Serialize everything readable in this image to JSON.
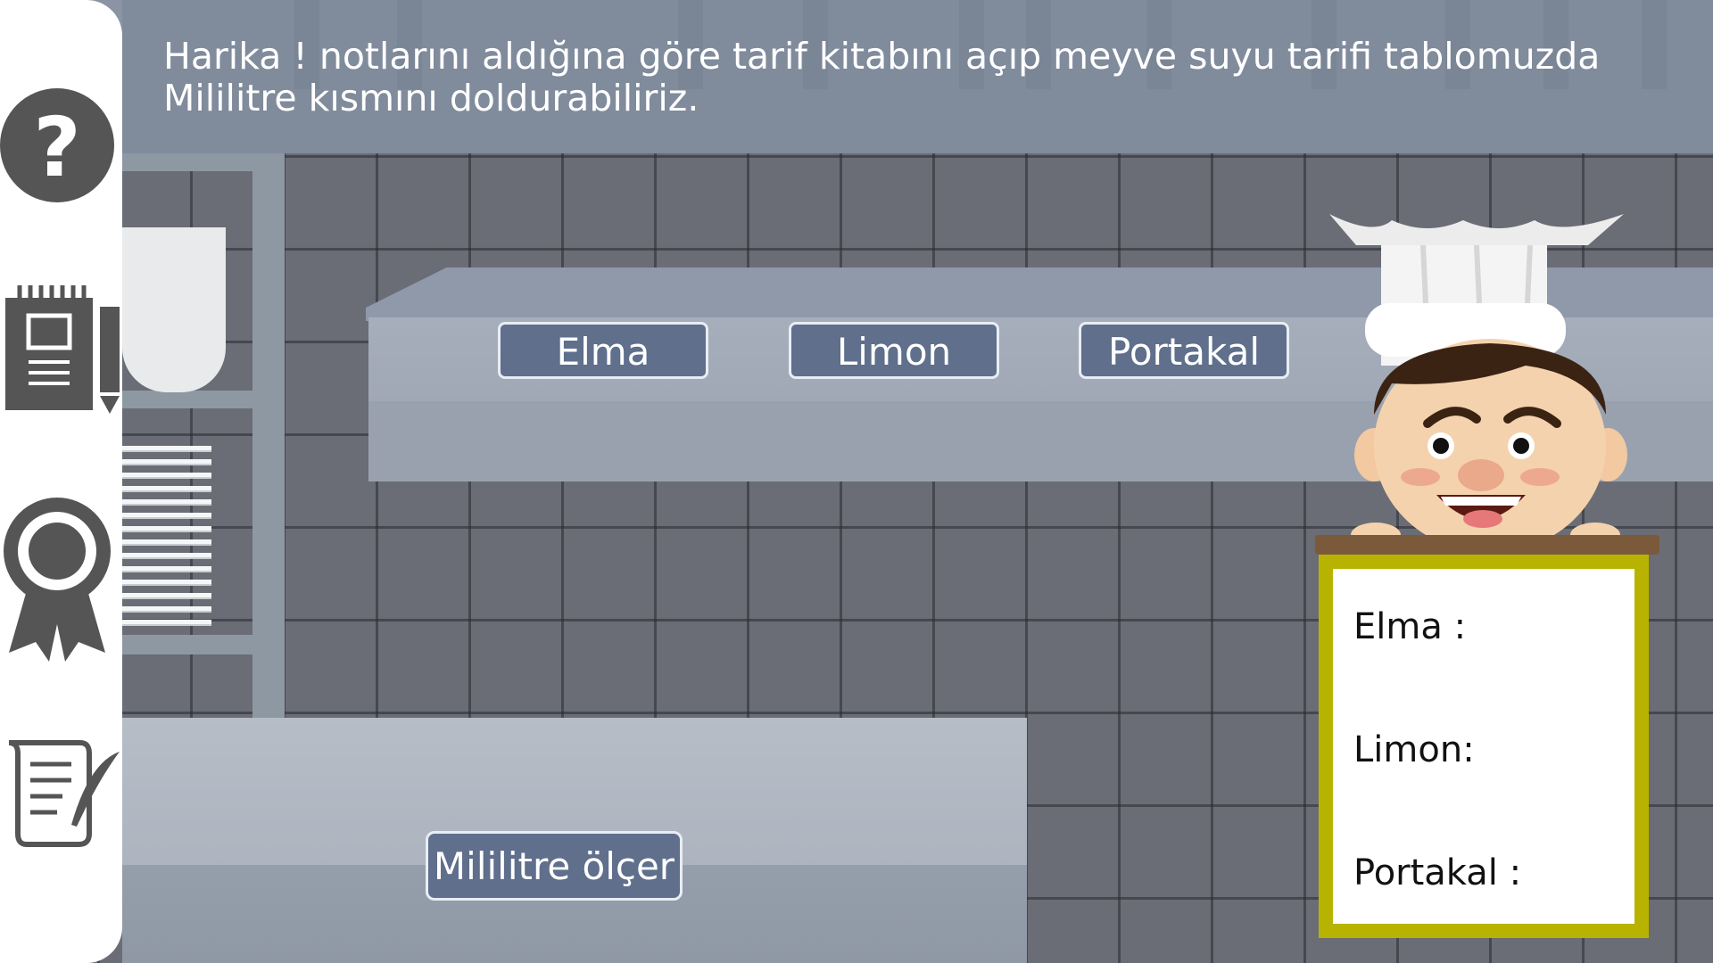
{
  "instruction": {
    "text": "Harika ! notlarını aldığına göre tarif kitabını açıp meyve suyu tarifi tablomuzda Mililitre kısmını doldurabiliriz."
  },
  "fruit_buttons": [
    {
      "label": "Elma"
    },
    {
      "label": "Limon"
    },
    {
      "label": "Portakal"
    }
  ],
  "measure_button": {
    "label": "Mililitre ölçer"
  },
  "sidebar": {
    "items": [
      {
        "icon": "help-icon"
      },
      {
        "icon": "notebook-icon"
      },
      {
        "icon": "badge-icon"
      },
      {
        "icon": "scroll-quill-icon"
      }
    ]
  },
  "recipe_board": {
    "lines": [
      {
        "label": "Elma :"
      },
      {
        "label": "Limon:"
      },
      {
        "label": "Portakal :"
      }
    ]
  },
  "colors": {
    "button_bg": "#5f6f8c",
    "board_frame": "#b8b300",
    "icon_gray": "#555555"
  }
}
